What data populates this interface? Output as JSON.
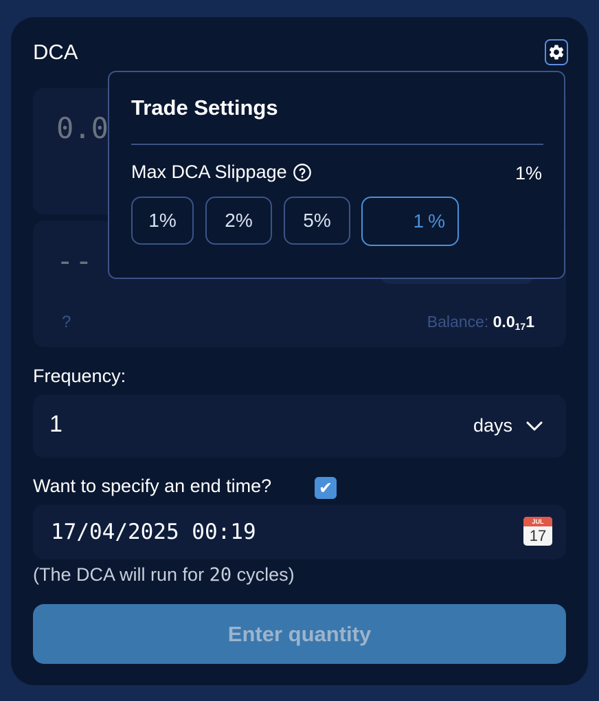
{
  "header": {
    "title": "DCA"
  },
  "input_from": {
    "placeholder": "0.0"
  },
  "input_to": {
    "value": "--",
    "help_mark": "?",
    "balance_label": "Balance:",
    "balance_value_prefix": "0.0",
    "balance_value_sub": "17",
    "balance_value_suffix": "1"
  },
  "trade_settings": {
    "title": "Trade Settings",
    "slippage_label": "Max DCA Slippage",
    "slippage_value": "1%",
    "options": [
      "1%",
      "2%",
      "5%"
    ],
    "custom_value": "1",
    "custom_unit": "%"
  },
  "frequency": {
    "label": "Frequency:",
    "value": "1",
    "unit": "days"
  },
  "end_time": {
    "label": "Want to specify an end time?",
    "checked": true,
    "checkbox_glyph": "✔",
    "datetime": "17/04/2025 00:19",
    "calendar_month": "JUL",
    "calendar_day": "17"
  },
  "cycles": {
    "prefix": "(The DCA will run for ",
    "count": "20",
    "suffix": " cycles)"
  },
  "submit": {
    "label": "Enter quantity"
  },
  "icons": {
    "settings": "gear-icon",
    "help": "question-circle-icon",
    "dropdown": "chevron-down-icon",
    "calendar": "calendar-icon"
  },
  "colors": {
    "background": "#142a52",
    "card": "#0a1730",
    "panel": "#0f1d3b",
    "accent": "#4a90d9",
    "button": "#3a77ad",
    "border": "#3a5488"
  }
}
